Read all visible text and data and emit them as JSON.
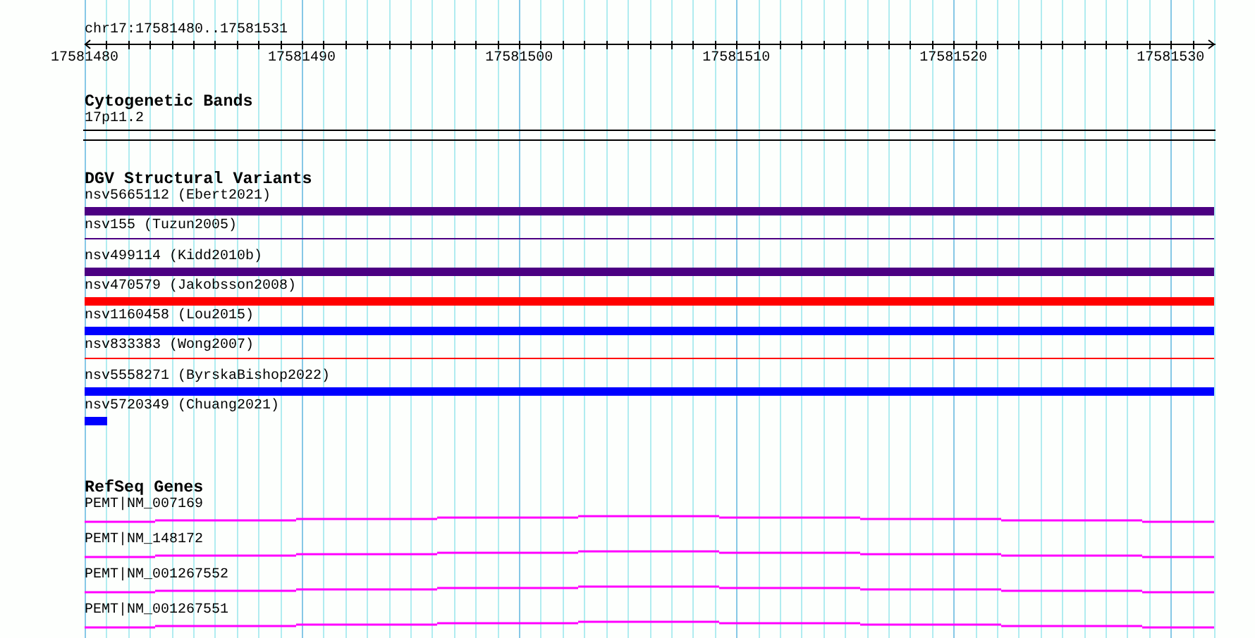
{
  "location": "chr17:17581480..17581531",
  "ruler": {
    "ticks": [
      "17581480",
      "17581490",
      "17581500",
      "17581510",
      "17581520",
      "17581530"
    ]
  },
  "cytogenetic_bands": {
    "title": "Cytogenetic Bands",
    "features": [
      {
        "label": "17p11.2"
      }
    ]
  },
  "dgv_structural_variants": {
    "title": "DGV Structural Variants",
    "features": [
      {
        "label": "nsv5665112 (Ebert2021)",
        "kind": "bar",
        "color": "#4b0082"
      },
      {
        "label": "nsv155 (Tuzun2005)",
        "kind": "line",
        "color": "#4b0082"
      },
      {
        "label": "nsv499114 (Kidd2010b)",
        "kind": "bar",
        "color": "#4b0082"
      },
      {
        "label": "nsv470579 (Jakobsson2008)",
        "kind": "bar",
        "color": "#ff0000"
      },
      {
        "label": "nsv1160458 (Lou2015)",
        "kind": "bar",
        "color": "#0000ff"
      },
      {
        "label": "nsv833383 (Wong2007)",
        "kind": "line",
        "color": "#ff0000"
      },
      {
        "label": "nsv5558271 (ByrskaBishop2022)",
        "kind": "bar",
        "color": "#0000ff"
      },
      {
        "label": "nsv5720349 (Chuang2021)",
        "kind": "short-bar",
        "color": "#0000ff"
      }
    ]
  },
  "refseq_genes": {
    "title": "RefSeq Genes",
    "features": [
      {
        "label": "PEMT|NM_007169"
      },
      {
        "label": "PEMT|NM_148172"
      },
      {
        "label": "PEMT|NM_001267552"
      },
      {
        "label": "PEMT|NM_001267551"
      }
    ]
  }
}
